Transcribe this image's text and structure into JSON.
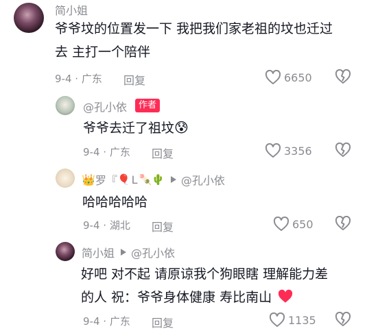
{
  "comments": [
    {
      "author": "简小姐",
      "text_lines": [
        "爷爷坟的位置发一下 我把我们家老祖的坟也迁过",
        "去 主打一个陪伴"
      ],
      "date": "9-4",
      "location": "广东",
      "reply_label": "回复",
      "likes": "6650",
      "avatar_color": "#3a1f2e"
    },
    {
      "author": "@孔小依",
      "badge": "作者",
      "text_lines": [
        "爷爷去迁了祖坟"
      ],
      "emoji": "😰",
      "date": "9-4",
      "location": "广东",
      "reply_label": "回复",
      "likes": "3356",
      "avatar_color": "#cfd6cf"
    },
    {
      "author": "罗『",
      "author_tail": "L",
      "reply_to": "@孔小依",
      "text_lines": [
        "哈哈哈哈哈"
      ],
      "date": "9-4",
      "location": "湖北",
      "reply_label": "回复",
      "likes": "650",
      "avatar_color": "#e9dccb"
    },
    {
      "author": "简小姐",
      "reply_to": "@孔小依",
      "text_lines": [
        "好吧 对不起 请原谅我个狗眼瞎 理解能力差",
        "的人 祝：爷爷身体健康  寿比南山"
      ],
      "date": "9-4",
      "location": "广东",
      "reply_label": "回复",
      "likes": "1135",
      "avatar_color": "#3a1f2e"
    }
  ],
  "colors": {
    "text": "#161823",
    "muted": "#8a8b91",
    "badge": "#fe2c55",
    "heart": "#fe2c55"
  },
  "icons": [
    "like-heart-icon",
    "dislike-broken-heart-icon",
    "reply-arrow-icon",
    "crown-emoji",
    "balloon-emoji",
    "candy-emoji",
    "cactus-emoji",
    "sweat-emoji",
    "red-heart-emoji"
  ]
}
